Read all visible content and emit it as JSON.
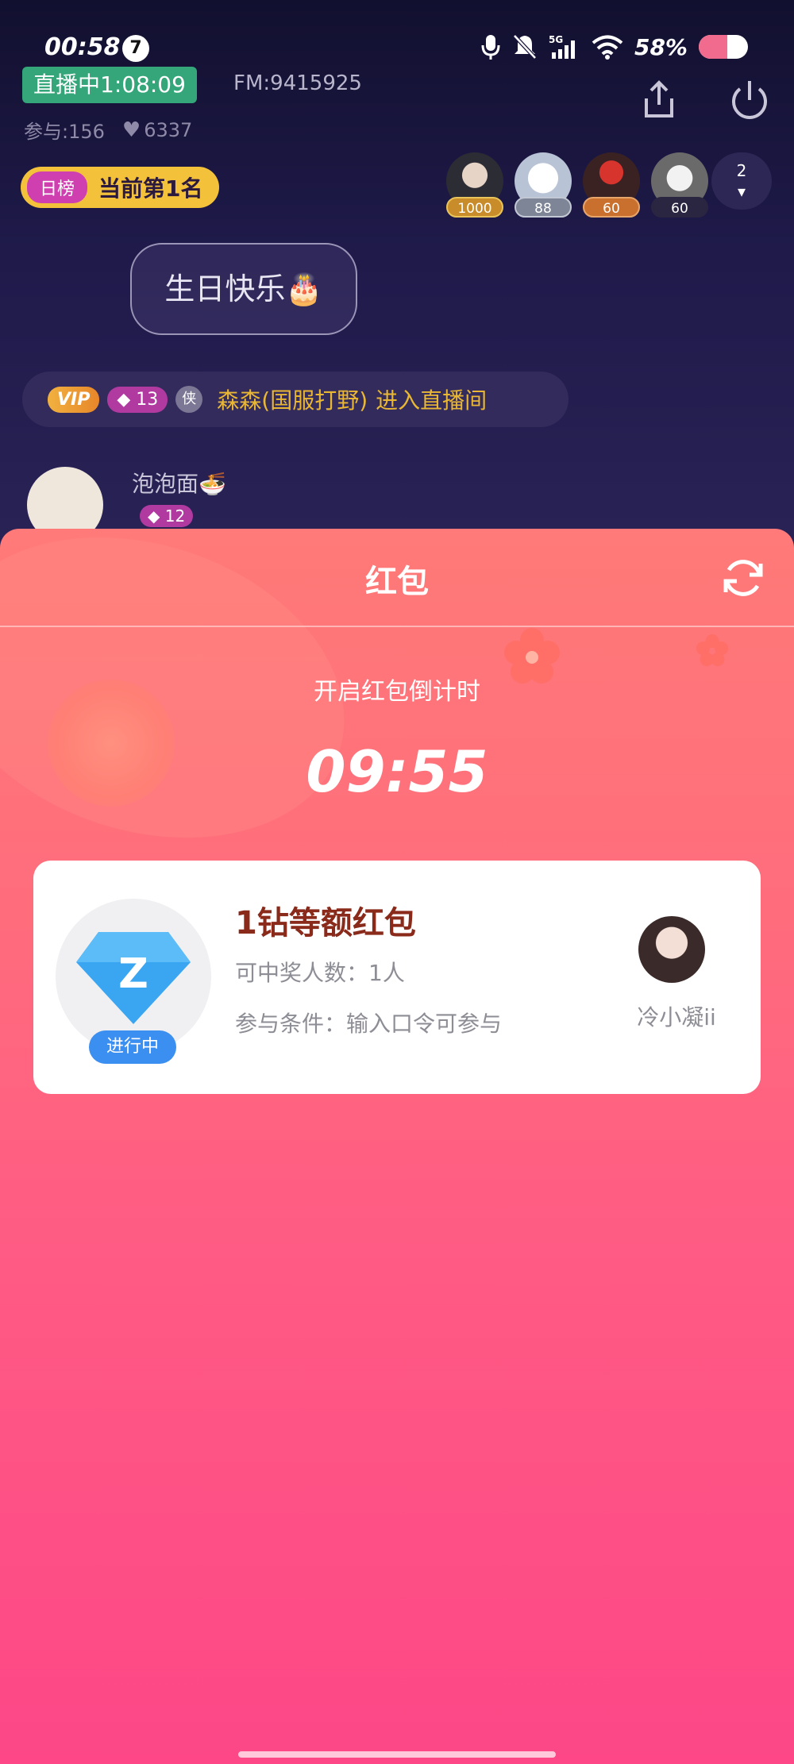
{
  "status_bar": {
    "time": "00:58",
    "notification_count": "7",
    "battery": "58%",
    "battery_level": 0.58,
    "network": "5G"
  },
  "live": {
    "status_label": "直播中1:08:09",
    "fm_id": "FM:9415925",
    "participants": "参与:156",
    "likes": "6337",
    "rank_tag": "日榜",
    "rank_text": "当前第1名",
    "top_users": [
      {
        "score": "1000"
      },
      {
        "score": "88"
      },
      {
        "score": "60"
      },
      {
        "score": "60"
      }
    ],
    "more_count": "2"
  },
  "chat": {
    "bubble_text": "生日快乐🎂",
    "enter": {
      "vip": "VIP",
      "level": "13",
      "guard": "侠",
      "name": "森森(国服打野)",
      "message": "进入直播间"
    },
    "message": {
      "name": "泡泡面🍜",
      "level": "12"
    }
  },
  "red_packet": {
    "title": "红包",
    "countdown_label": "开启红包倒计时",
    "countdown": "09:55",
    "card": {
      "title": "1钻等额红包",
      "winners": "可中奖人数：1人",
      "condition": "参与条件：输入口令可参与",
      "status": "进行中",
      "icon_letter": "Z",
      "host_name": "冷小凝ii"
    }
  },
  "colors": {
    "live_green": "#35a57a",
    "rank_yellow": "#f3c23a",
    "panel_top": "#ff7a78",
    "panel_bottom": "#fd4787",
    "status_blue": "#3b8ff0",
    "title_brown": "#8a2a1a"
  }
}
